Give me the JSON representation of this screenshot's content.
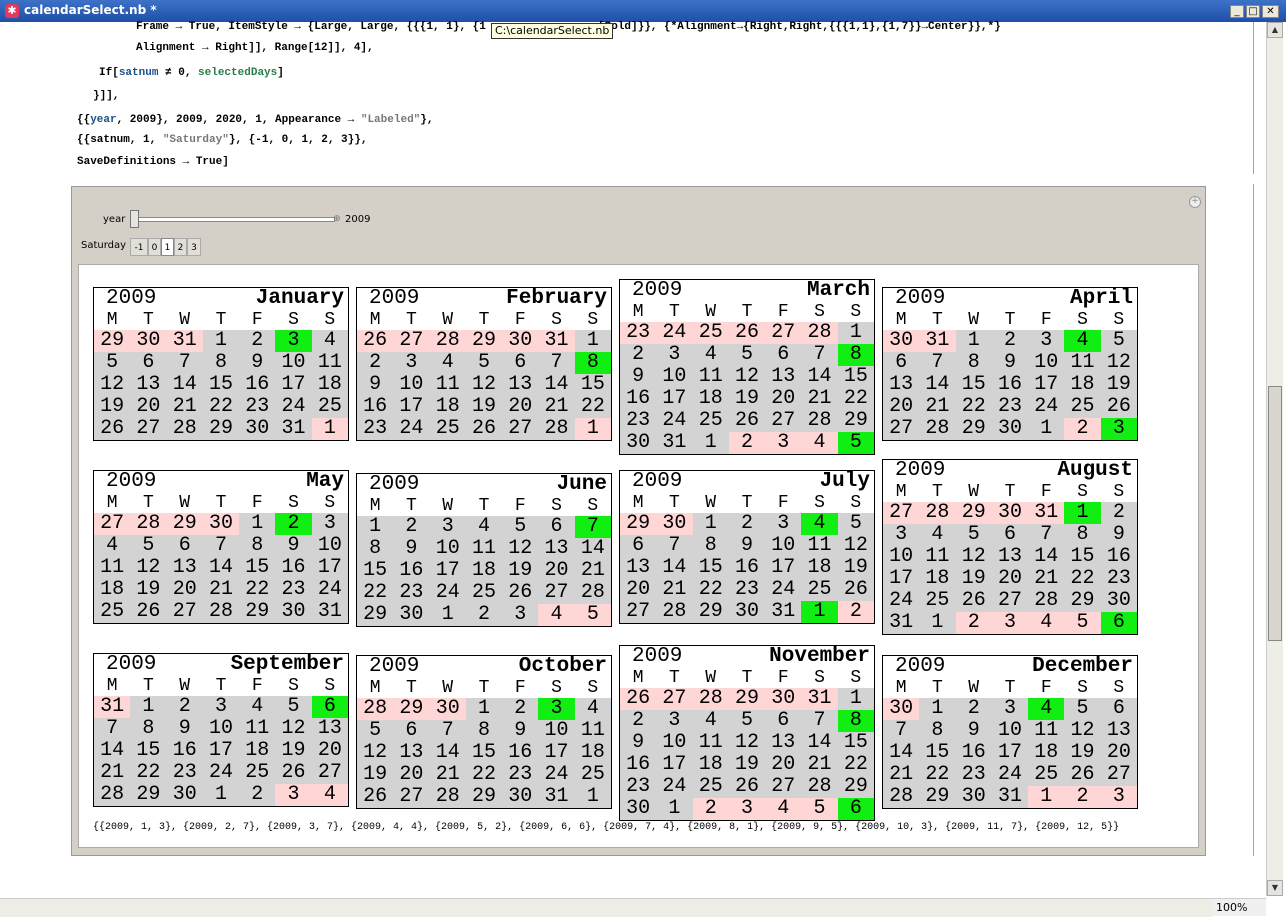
{
  "window": {
    "title": "calendarSelect.nb *",
    "tooltip": "C:\\calendarSelect.nb"
  },
  "colors": {
    "current_month": "#d3d3d3",
    "adjacent_month": "#ffd6d6",
    "selected_day": "#11ee11",
    "title_bar": "#2457b3"
  },
  "code_lines": [
    "Frame → True, ItemStyle → {Large, Large, {{{1, 1}, {1",
    "[Bold]}}, {*Alignment→{Right,Right,{{{1,1},{1,7}}→Center}},*}",
    "Alignment → Right]], Range[12]], 4],",
    "If[",
    "satnum",
    " ≠ 0, ",
    "selectedDays",
    "]",
    "}]],",
    "{{",
    "year",
    ", 2009}, 2009, 2020, 1, Appearance → ",
    "\"Labeled\"",
    "},",
    "{{satnum, 1, ",
    "\"Saturday\"",
    "}, {-1, 0, 1, 2, 3}},",
    "SaveDefinitions → True]"
  ],
  "controls": {
    "year_label": "year",
    "year_value": "2009",
    "year_min": 2009,
    "year_max": 2020,
    "year_current": 2009,
    "saturday_label": "Saturday",
    "saturday_options": [
      "-1",
      "0",
      "1",
      "2",
      "3"
    ],
    "saturday_selected": "1"
  },
  "calendar": {
    "year": "2009",
    "dow": [
      "M",
      "T",
      "W",
      "T",
      "F",
      "S",
      "S"
    ],
    "months": [
      {
        "name": "January",
        "days": [
          "29",
          "30",
          "31",
          "1",
          "2",
          "3",
          "4",
          "5",
          "6",
          "7",
          "8",
          "9",
          "10",
          "11",
          "12",
          "13",
          "14",
          "15",
          "16",
          "17",
          "18",
          "19",
          "20",
          "21",
          "22",
          "23",
          "24",
          "25",
          "26",
          "27",
          "28",
          "29",
          "30",
          "31",
          "1"
        ],
        "types": "aaaccscccccccccccccccccccccccccccca"
      },
      {
        "name": "February",
        "days": [
          "26",
          "27",
          "28",
          "29",
          "30",
          "31",
          "1",
          "2",
          "3",
          "4",
          "5",
          "6",
          "7",
          "8",
          "9",
          "10",
          "11",
          "12",
          "13",
          "14",
          "15",
          "16",
          "17",
          "18",
          "19",
          "20",
          "21",
          "22",
          "23",
          "24",
          "25",
          "26",
          "27",
          "28",
          "1"
        ],
        "types": "aaaaaacccccccscccccccccccccccccccca"
      },
      {
        "name": "March",
        "days": [
          "23",
          "24",
          "25",
          "26",
          "27",
          "28",
          "1",
          "2",
          "3",
          "4",
          "5",
          "6",
          "7",
          "8",
          "9",
          "10",
          "11",
          "12",
          "13",
          "14",
          "15",
          "16",
          "17",
          "18",
          "19",
          "20",
          "21",
          "22",
          "23",
          "24",
          "25",
          "26",
          "27",
          "28",
          "29",
          "30",
          "31",
          "1",
          "2",
          "3",
          "4",
          "5"
        ],
        "types": "aaaaaacccccccsccccccccccccccccccccccccaaasa"
      },
      {
        "name": "April",
        "days": [
          "30",
          "31",
          "1",
          "2",
          "3",
          "4",
          "5",
          "6",
          "7",
          "8",
          "9",
          "10",
          "11",
          "12",
          "13",
          "14",
          "15",
          "16",
          "17",
          "18",
          "19",
          "20",
          "21",
          "22",
          "23",
          "24",
          "25",
          "26",
          "27",
          "28",
          "29",
          "30",
          "1",
          "2",
          "3"
        ],
        "types": "aacccscccccccccccccccccccccccccccasa"
      },
      {
        "name": "May",
        "days": [
          "27",
          "28",
          "29",
          "30",
          "1",
          "2",
          "3",
          "4",
          "5",
          "6",
          "7",
          "8",
          "9",
          "10",
          "11",
          "12",
          "13",
          "14",
          "15",
          "16",
          "17",
          "18",
          "19",
          "20",
          "21",
          "22",
          "23",
          "24",
          "25",
          "26",
          "27",
          "28",
          "29",
          "30",
          "31"
        ],
        "types": "aaaacsccccccccccccccccccccccccccccc"
      },
      {
        "name": "June",
        "days": [
          "1",
          "2",
          "3",
          "4",
          "5",
          "6",
          "7",
          "8",
          "9",
          "10",
          "11",
          "12",
          "13",
          "14",
          "15",
          "16",
          "17",
          "18",
          "19",
          "20",
          "21",
          "22",
          "23",
          "24",
          "25",
          "26",
          "27",
          "28",
          "29",
          "30",
          "1",
          "2",
          "3",
          "4",
          "5"
        ],
        "types": "ccccccsccccccccccccccccccccccccccaaasa"
      },
      {
        "name": "July",
        "days": [
          "29",
          "30",
          "1",
          "2",
          "3",
          "4",
          "5",
          "6",
          "7",
          "8",
          "9",
          "10",
          "11",
          "12",
          "13",
          "14",
          "15",
          "16",
          "17",
          "18",
          "19",
          "20",
          "21",
          "22",
          "23",
          "24",
          "25",
          "26",
          "27",
          "28",
          "29",
          "30",
          "31",
          "1",
          "2"
        ],
        "types": "aacccscccccccccccccccccccccccccccsa"
      },
      {
        "name": "August",
        "days": [
          "27",
          "28",
          "29",
          "30",
          "31",
          "1",
          "2",
          "3",
          "4",
          "5",
          "6",
          "7",
          "8",
          "9",
          "10",
          "11",
          "12",
          "13",
          "14",
          "15",
          "16",
          "17",
          "18",
          "19",
          "20",
          "21",
          "22",
          "23",
          "24",
          "25",
          "26",
          "27",
          "28",
          "29",
          "30",
          "31",
          "1",
          "2",
          "3",
          "4",
          "5",
          "6"
        ],
        "types": "aaaaascccccccccccccccccccccccccccccccaaaasa"
      },
      {
        "name": "September",
        "days": [
          "31",
          "1",
          "2",
          "3",
          "4",
          "5",
          "6",
          "7",
          "8",
          "9",
          "10",
          "11",
          "12",
          "13",
          "14",
          "15",
          "16",
          "17",
          "18",
          "19",
          "20",
          "21",
          "22",
          "23",
          "24",
          "25",
          "26",
          "27",
          "28",
          "29",
          "30",
          "1",
          "2",
          "3",
          "4"
        ],
        "types": "acccccsccccccccccccccccccccccccccaasa"
      },
      {
        "name": "October",
        "days": [
          "28",
          "29",
          "30",
          "1",
          "2",
          "3",
          "4",
          "5",
          "6",
          "7",
          "8",
          "9",
          "10",
          "11",
          "12",
          "13",
          "14",
          "15",
          "16",
          "17",
          "18",
          "19",
          "20",
          "21",
          "22",
          "23",
          "24",
          "25",
          "26",
          "27",
          "28",
          "29",
          "30",
          "31",
          "1"
        ],
        "types": "aaaccsccccccccccccccccccccccccccccca"
      },
      {
        "name": "November",
        "days": [
          "26",
          "27",
          "28",
          "29",
          "30",
          "31",
          "1",
          "2",
          "3",
          "4",
          "5",
          "6",
          "7",
          "8",
          "9",
          "10",
          "11",
          "12",
          "13",
          "14",
          "15",
          "16",
          "17",
          "18",
          "19",
          "20",
          "21",
          "22",
          "23",
          "24",
          "25",
          "26",
          "27",
          "28",
          "29",
          "30",
          "1",
          "2",
          "3",
          "4",
          "5",
          "6"
        ],
        "types": "aaaaaacccccccscccccccccccccccccccccccaaaasa"
      },
      {
        "name": "December",
        "days": [
          "30",
          "1",
          "2",
          "3",
          "4",
          "5",
          "6",
          "7",
          "8",
          "9",
          "10",
          "11",
          "12",
          "13",
          "14",
          "15",
          "16",
          "17",
          "18",
          "19",
          "20",
          "21",
          "22",
          "23",
          "24",
          "25",
          "26",
          "27",
          "28",
          "29",
          "30",
          "31",
          "1",
          "2",
          "3"
        ],
        "types": "acccscccccccccccccccccccccccccccaaaa"
      }
    ]
  },
  "result_text": "{{2009, 1, 3}, {2009, 2, 7}, {2009, 3, 7}, {2009, 4, 4}, {2009, 5, 2}, {2009, 6, 6}, {2009, 7, 4}, {2009, 8, 1}, {2009, 9, 5}, {2009, 10, 3}, {2009, 11, 7}, {2009, 12, 5}}",
  "status": {
    "zoom": "100%"
  }
}
